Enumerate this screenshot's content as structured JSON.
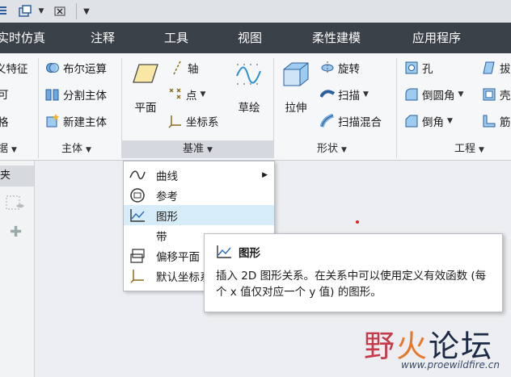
{
  "menu_tabs": [
    "实时仿真",
    "注释",
    "工具",
    "视图",
    "柔性建模",
    "应用程序"
  ],
  "ribbon": {
    "partial_left": [
      "义特征",
      "可",
      "格"
    ],
    "features_footer": "据",
    "body_group": {
      "items": [
        "布尔运算",
        "分割主体",
        "新建主体"
      ],
      "footer": "主体"
    },
    "datum_group": {
      "plane": "平面",
      "axis": "轴",
      "point": "点",
      "csys": "坐标系",
      "sketch": "草绘",
      "footer": "基准"
    },
    "shapes_group": {
      "extrude": "拉伸",
      "revolve": "旋转",
      "sweep": "扫描",
      "swept_blend": "扫描混合",
      "footer": "形状"
    },
    "engineering_group": {
      "hole": "孔",
      "round": "倒圆角",
      "chamfer": "倒角",
      "partial": [
        "拔",
        "壳",
        "筋"
      ],
      "footer": "工程"
    }
  },
  "left_panel": {
    "header": "夹"
  },
  "datum_dropdown": {
    "items": [
      "曲线",
      "参考",
      "图形",
      "带",
      "偏移平面",
      "默认坐标系"
    ],
    "highlighted": "图形"
  },
  "tooltip": {
    "title": "图形",
    "body": "插入 2D 图形关系。在关系中可以使用定义有效函数 (每个 x 值仅对应一个 y 值) 的图形。"
  },
  "watermark": {
    "text_red": "野",
    "text_orange": "火",
    "text_dark": "论坛",
    "url": "www.proewildfire.cn"
  },
  "colors": {
    "menubar": "#3b4148",
    "accent_blue": "#2b6cb0",
    "highlight": "#d6ecf9"
  }
}
